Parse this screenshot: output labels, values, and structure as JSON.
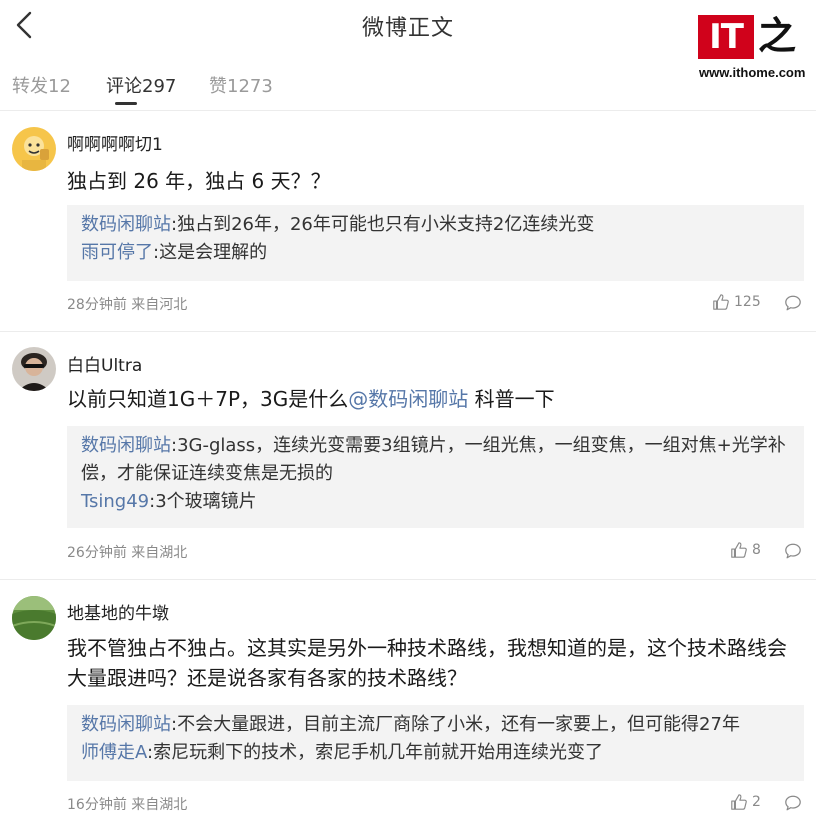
{
  "header": {
    "title": "微博正文"
  },
  "watermark": {
    "logo_text_it": "IT",
    "logo_text_zhi": "之",
    "url": "www.ithome.com"
  },
  "tabs": [
    {
      "label": "转发12"
    },
    {
      "label": "评论297"
    },
    {
      "label": "赞1273"
    }
  ],
  "comments": [
    {
      "user": "啊啊啊啊切1",
      "text": "独占到 26 年，独占 6 天？？",
      "replies": [
        {
          "user": "数码闲聊站",
          "text": ":独占到26年，26年可能也只有小米支持2亿连续光变"
        },
        {
          "user": "雨可停了",
          "text": ":这是会理解的"
        }
      ],
      "meta": "28分钟前 来自河北",
      "likes": "125"
    },
    {
      "user": "白白Ultra",
      "text_before": "以前只知道1G＋7P，3G是什么",
      "mention": "@数码闲聊站",
      "text_after": " 科普一下",
      "replies": [
        {
          "user": "数码闲聊站",
          "text": ":3G-glass，连续光变需要3组镜片，一组光焦，一组变焦，一组对焦+光学补偿，才能保证连续变焦是无损的"
        },
        {
          "user": "Tsing49",
          "text": ":3个玻璃镜片"
        }
      ],
      "meta": "26分钟前 来自湖北",
      "likes": "8"
    },
    {
      "user": "地基地的牛墩",
      "text": "我不管独占不独占。这其实是另外一种技术路线，我想知道的是，这个技术路线会大量跟进吗？还是说各家有各家的技术路线？",
      "replies": [
        {
          "user": "数码闲聊站",
          "text": ":不会大量跟进，目前主流厂商除了小米，还有一家要上，但可能得27年"
        },
        {
          "user": "师傅走A",
          "text": ":索尼玩剩下的技术，索尼手机几年前就开始用连续光变了"
        }
      ],
      "meta": "16分钟前 来自湖北",
      "likes": "2"
    }
  ],
  "icons": {
    "back": "chevron-left-icon",
    "like": "thumbs-up-icon",
    "reply": "speech-bubble-icon"
  },
  "colors": {
    "link": "#5677a8",
    "logo_red": "#d0021b",
    "reply_bg": "#f3f3f3"
  }
}
